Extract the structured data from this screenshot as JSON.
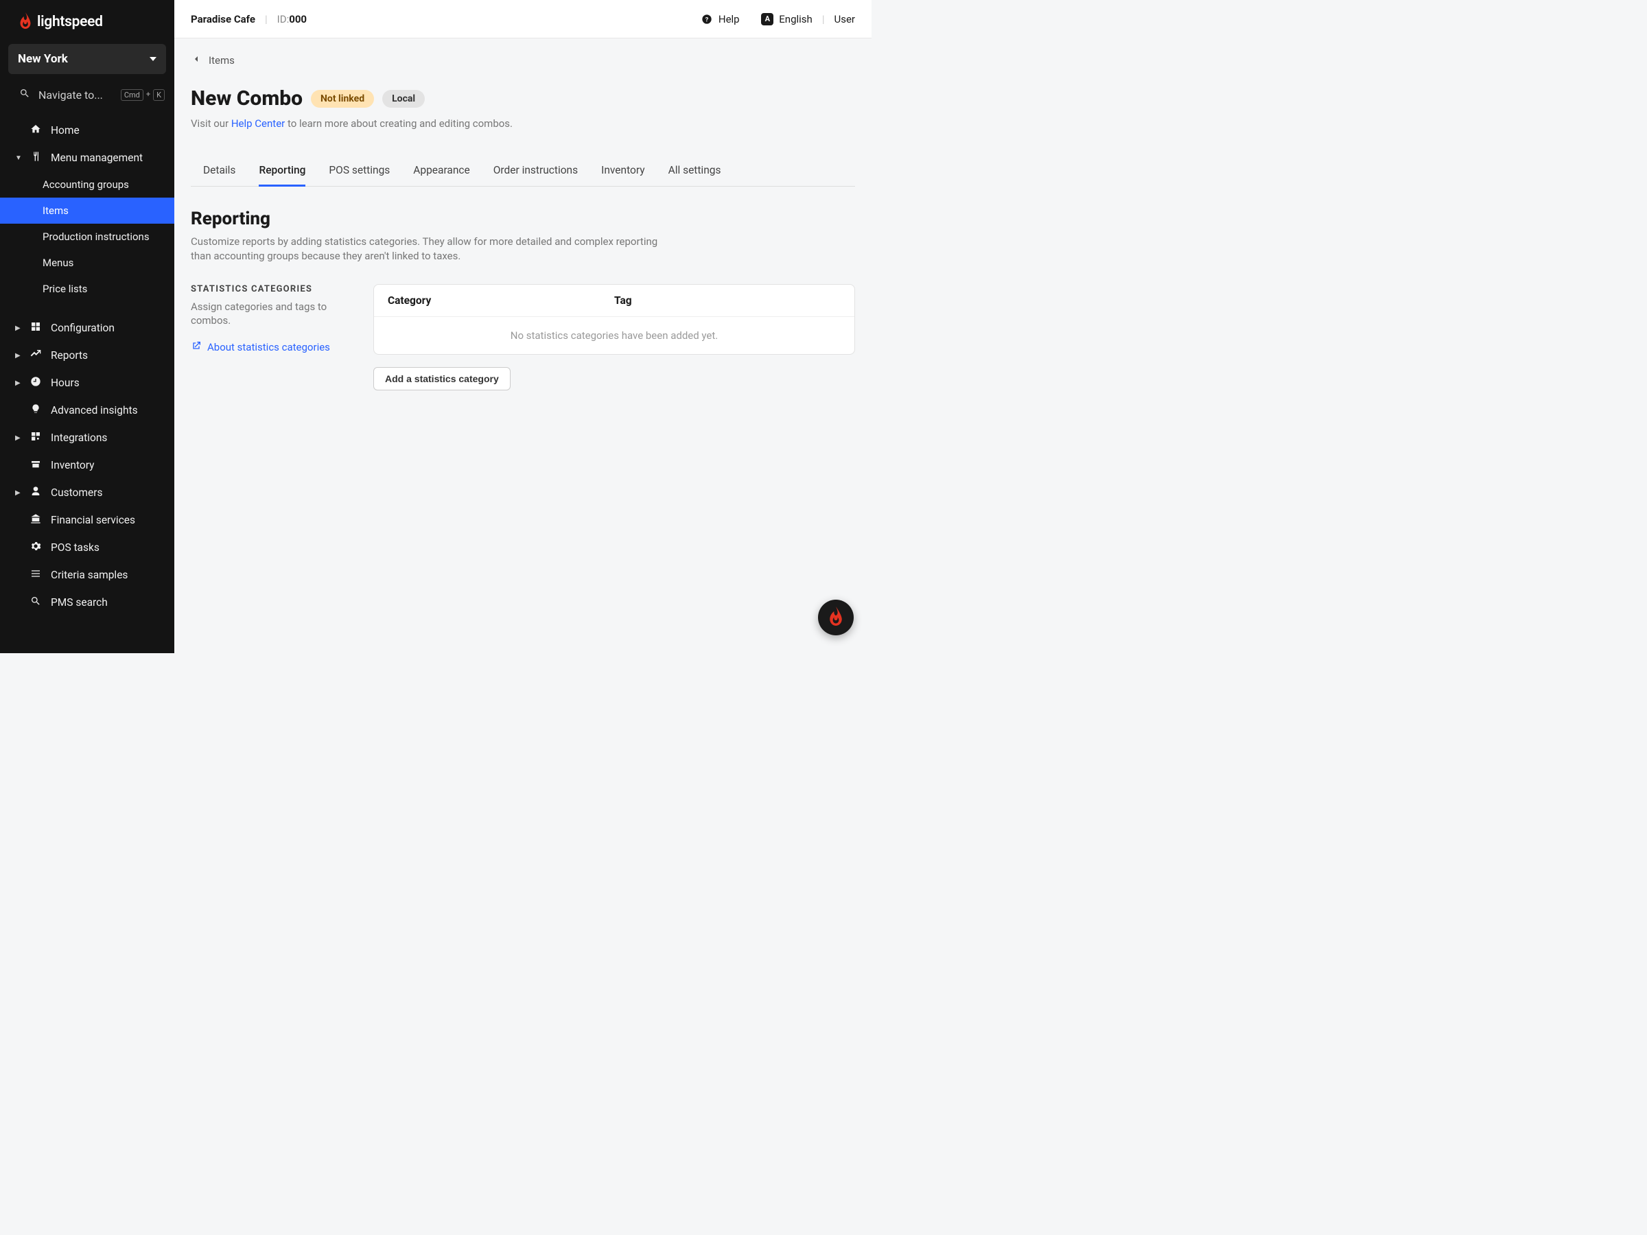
{
  "brand": "lightspeed",
  "location": "New York",
  "search_placeholder": "Navigate to...",
  "kbd": {
    "mod": "Cmd",
    "key": "K"
  },
  "nav": {
    "home": "Home",
    "menu_management": "Menu management",
    "sub": {
      "accounting_groups": "Accounting groups",
      "items": "Items",
      "production_instructions": "Production instructions",
      "menus": "Menus",
      "price_lists": "Price lists"
    },
    "configuration": "Configuration",
    "reports": "Reports",
    "hours": "Hours",
    "advanced_insights": "Advanced insights",
    "integrations": "Integrations",
    "inventory": "Inventory",
    "customers": "Customers",
    "financial_services": "Financial services",
    "pos_tasks": "POS tasks",
    "criteria_samples": "Criteria samples",
    "pms_search": "PMS search"
  },
  "topbar": {
    "org": "Paradise Cafe",
    "id_label": "ID: ",
    "id_value": "000",
    "help": "Help",
    "lang_badge": "A",
    "language": "English",
    "user": "User"
  },
  "breadcrumb": "Items",
  "page": {
    "title": "New Combo",
    "badge_not_linked": "Not linked",
    "badge_local": "Local",
    "sub_pre": "Visit our ",
    "sub_link": "Help Center",
    "sub_post": " to learn more about creating and editing combos."
  },
  "tabs": [
    "Details",
    "Reporting",
    "POS settings",
    "Appearance",
    "Order instructions",
    "Inventory",
    "All settings"
  ],
  "active_tab": "Reporting",
  "section": {
    "heading": "Reporting",
    "desc": "Customize reports by adding statistics categories. They allow for more detailed and complex reporting than accounting groups because they aren't linked to taxes.",
    "side_label": "STATISTICS CATEGORIES",
    "side_desc": "Assign categories and tags to combos.",
    "about_link": "About statistics categories",
    "th_cat": "Category",
    "th_tag": "Tag",
    "empty": "No statistics categories have been added yet.",
    "add_button": "Add a statistics category"
  }
}
